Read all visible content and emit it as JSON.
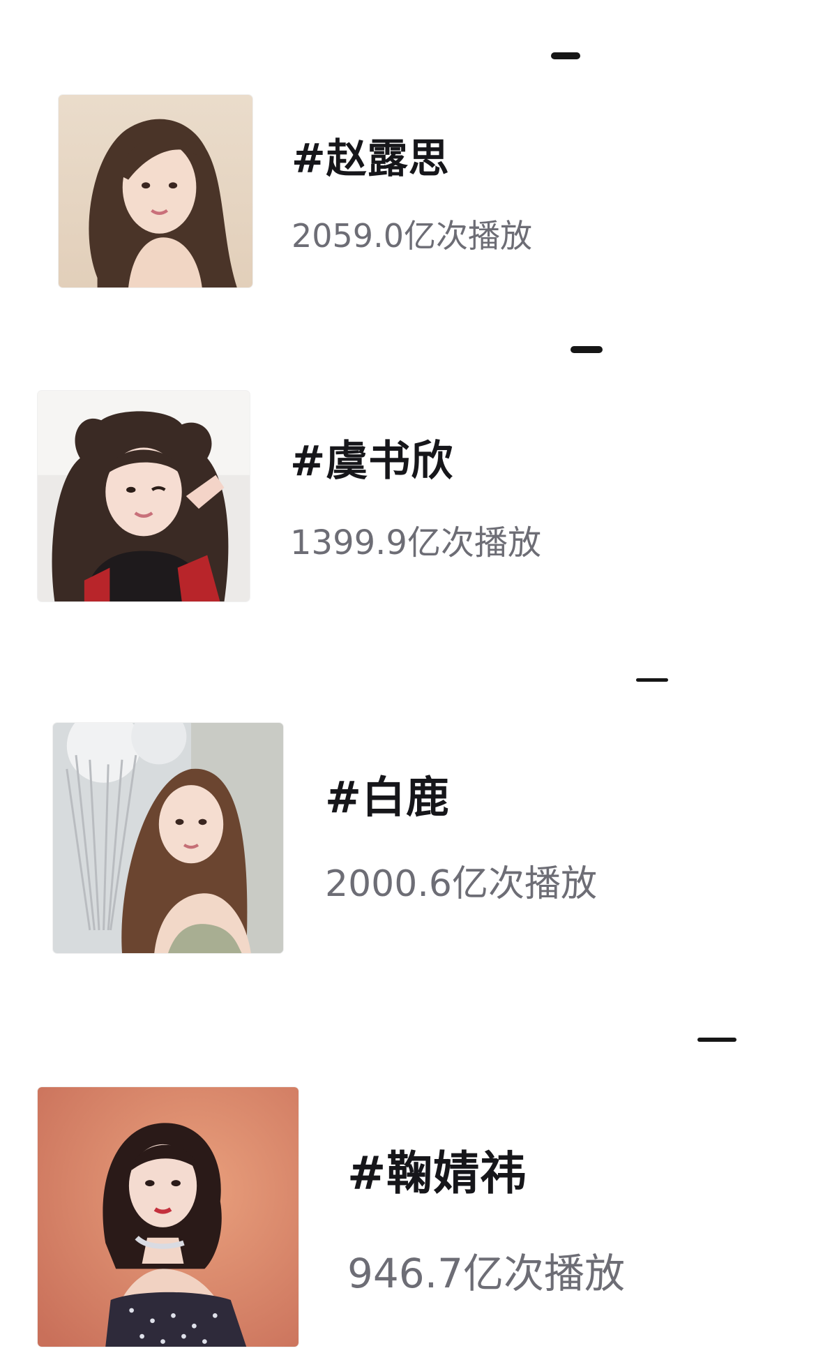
{
  "rankings": [
    {
      "tag": "#赵露思",
      "plays": "2059.0亿次播放",
      "avatar_icon": "portrait-icon"
    },
    {
      "tag": "#虞书欣",
      "plays": "1399.9亿次播放",
      "avatar_icon": "portrait-icon"
    },
    {
      "tag": "#白鹿",
      "plays": "2000.6亿次播放",
      "avatar_icon": "portrait-icon"
    },
    {
      "tag": "#鞠婧祎",
      "plays": "946.7亿次播放",
      "avatar_icon": "portrait-icon"
    }
  ],
  "colors": {
    "tag_text": "#16161a",
    "plays_text": "#6d6d75",
    "dash": "#161616",
    "background": "#ffffff"
  }
}
